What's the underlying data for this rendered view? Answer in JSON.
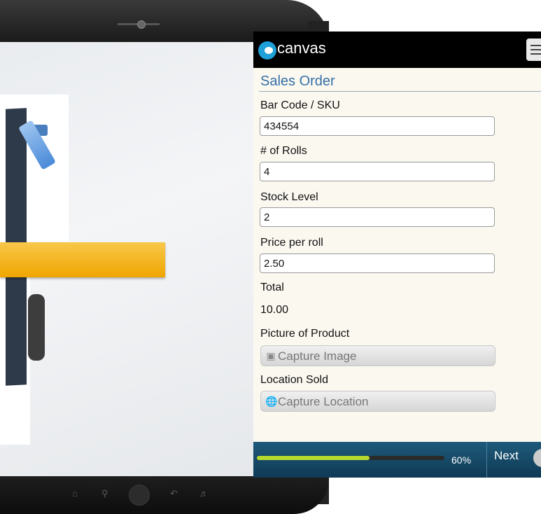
{
  "app": {
    "logo_text": "canvas",
    "brand_color": "#1fa0d8"
  },
  "form": {
    "title": "Sales Order",
    "fields": [
      {
        "label": "Bar Code / SKU",
        "value": "434554"
      },
      {
        "label": "# of Rolls",
        "value": "4"
      },
      {
        "label": "Stock Level",
        "value": "2"
      },
      {
        "label": "Price per roll",
        "value": "2.50"
      }
    ],
    "total": {
      "label": "Total",
      "value": "10.00"
    },
    "picture": {
      "label": "Picture of Product",
      "button": "Capture Image",
      "icon": "camera-icon"
    },
    "location": {
      "label": "Location Sold",
      "button": "Capture Location",
      "icon": "globe-icon"
    }
  },
  "footer": {
    "progress_percent": 60,
    "progress_text": "60%",
    "next_label": "Next",
    "progress_color": "#b6d92e"
  }
}
